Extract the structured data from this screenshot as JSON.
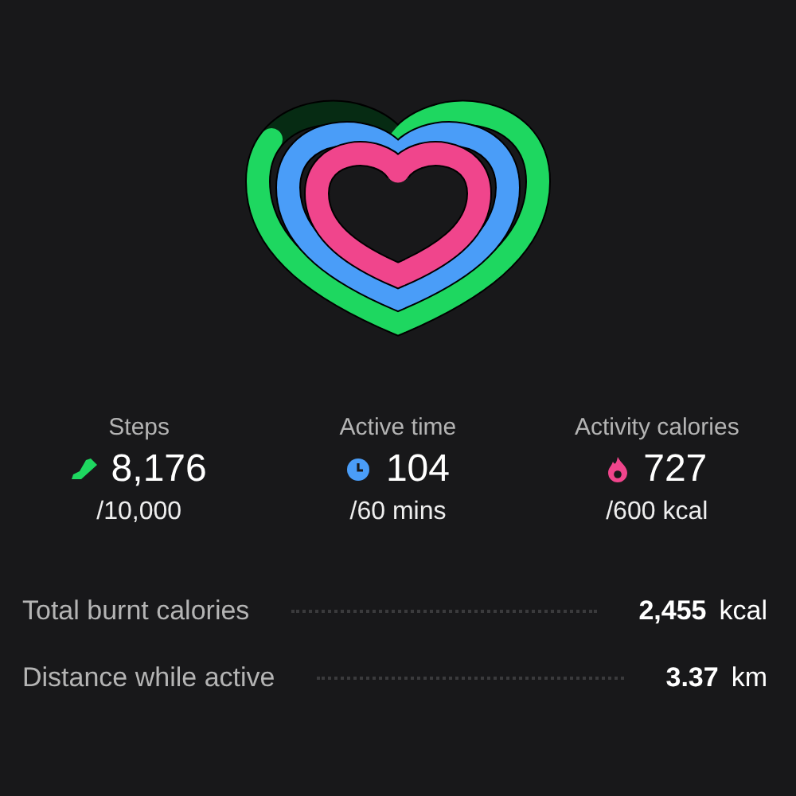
{
  "stats": [
    {
      "kind": "steps",
      "label": "Steps",
      "value": "8,176",
      "goal": "/10,000",
      "color": "#1ed760"
    },
    {
      "kind": "time",
      "label": "Active time",
      "value": "104",
      "goal": "/60 mins",
      "color": "#4a9df8"
    },
    {
      "kind": "calories",
      "label": "Activity calories",
      "value": "727",
      "goal": "/600 kcal",
      "color": "#f0458c"
    }
  ],
  "summary": [
    {
      "label": "Total burnt calories",
      "value": "2,455",
      "unit": "kcal"
    },
    {
      "label": "Distance while active",
      "value": "3.37",
      "unit": "km"
    }
  ]
}
